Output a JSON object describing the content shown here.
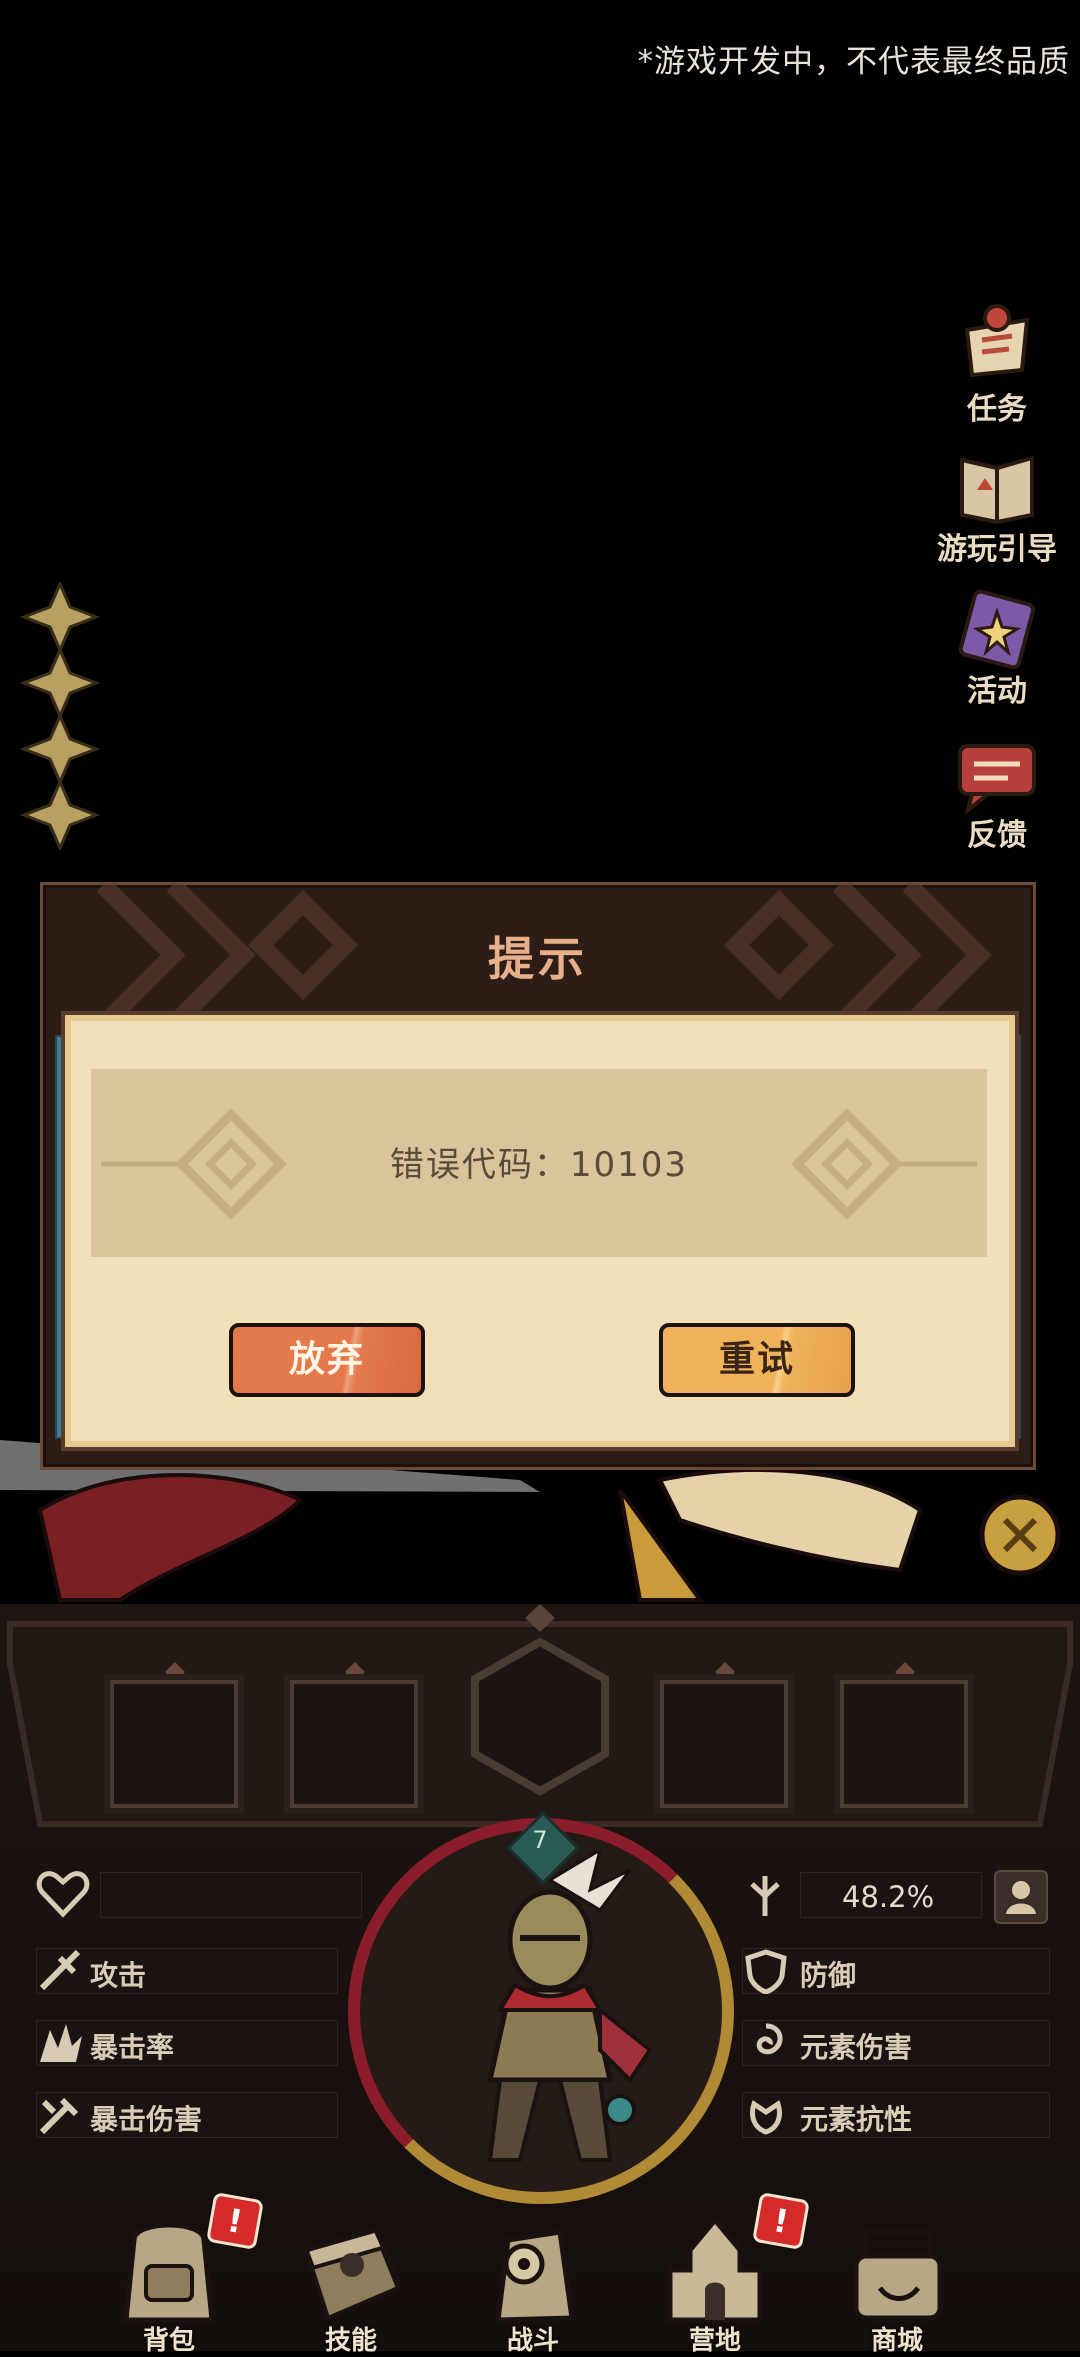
{
  "disclaimer": "*游戏开发中，不代表最终品质",
  "side_menu": [
    {
      "label": "任务",
      "icon": "quest-icon"
    },
    {
      "label": "游玩引导",
      "icon": "guide-book-icon"
    },
    {
      "label": "活动",
      "icon": "event-scroll-icon"
    },
    {
      "label": "反馈",
      "icon": "feedback-icon"
    }
  ],
  "dialog": {
    "title": "提示",
    "message": "错误代码：10103",
    "buttons": {
      "give_up": "放弃",
      "retry": "重试"
    }
  },
  "character": {
    "level": "7",
    "progress_text": "48.2%"
  },
  "stats_left": [
    "攻击",
    "暴击率",
    "暴击伤害"
  ],
  "stats_right": [
    "防御",
    "元素伤害",
    "元素抗性"
  ],
  "bottom_nav": [
    {
      "label": "背包",
      "icon": "backpack-icon",
      "alert": "!"
    },
    {
      "label": "技能",
      "icon": "skill-book-icon",
      "alert": ""
    },
    {
      "label": "战斗",
      "icon": "battle-icon",
      "alert": ""
    },
    {
      "label": "营地",
      "icon": "camp-castle-icon",
      "alert": "!"
    },
    {
      "label": "商城",
      "icon": "shop-icon",
      "alert": ""
    }
  ],
  "colors": {
    "give_up_button": "#e47a4c",
    "retry_button": "#f0b35a",
    "dialog_title": "#e7b08a",
    "hp_ring": "#8b1d2a",
    "exp_ring": "#b08a35"
  }
}
